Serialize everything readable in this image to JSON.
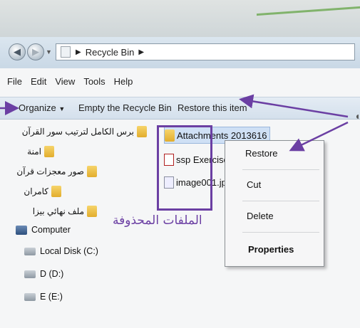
{
  "address": {
    "location": "Recycle Bin"
  },
  "menu": [
    "File",
    "Edit",
    "View",
    "Tools",
    "Help"
  ],
  "toolbar": {
    "organize": "Organize",
    "empty": "Empty the Recycle Bin",
    "restore": "Restore this item"
  },
  "tree": {
    "folders": [
      "برس الكامل لترتيب سور القرآن",
      "امنة",
      "صور معجزات قرآن",
      "كامران",
      "ملف نهائي بيزا"
    ],
    "computer": "Computer",
    "drives": [
      "Local Disk (C:)",
      "D (D:)",
      "E (E:)"
    ]
  },
  "files": [
    {
      "name": "Attachments 2013616",
      "icon": "folder-icon"
    },
    {
      "name": "ssp Exercise.p",
      "icon": "pdf-icon"
    },
    {
      "name": "image001.jpg",
      "icon": "image-file-icon"
    }
  ],
  "context_menu": {
    "restore": "Restore",
    "cut": "Cut",
    "delete": "Delete",
    "properties": "Properties"
  },
  "annotation": "الملفات المحذوفة",
  "colors": {
    "annotation": "#6b3fa3",
    "selection": "#cfe0f5"
  }
}
